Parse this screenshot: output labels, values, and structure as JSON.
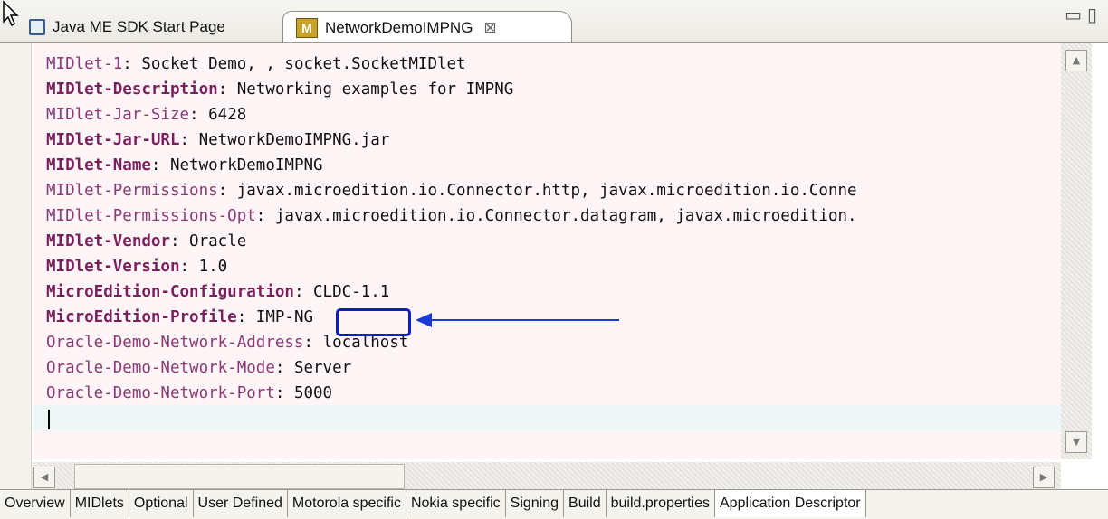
{
  "tabs": [
    {
      "label": "Java ME SDK Start Page",
      "icon": "start-page-icon"
    },
    {
      "label": "NetworkDemoIMPNG",
      "icon": "midlet-project-icon",
      "close": "⊠",
      "active": true
    }
  ],
  "editor": {
    "lines": [
      {
        "key": "MIDlet-1",
        "value": "Socket Demo, , socket.SocketMIDlet",
        "bold": false
      },
      {
        "key": "MIDlet-Description",
        "value": "Networking examples for IMPNG",
        "bold": true
      },
      {
        "key": "MIDlet-Jar-Size",
        "value": "6428",
        "bold": false
      },
      {
        "key": "MIDlet-Jar-URL",
        "value": "NetworkDemoIMPNG.jar",
        "bold": true
      },
      {
        "key": "MIDlet-Name",
        "value": "NetworkDemoIMPNG",
        "bold": true
      },
      {
        "key": "MIDlet-Permissions",
        "value": "javax.microedition.io.Connector.http, javax.microedition.io.Conne",
        "bold": false
      },
      {
        "key": "MIDlet-Permissions-Opt",
        "value": "javax.microedition.io.Connector.datagram, javax.microedition.",
        "bold": false
      },
      {
        "key": "MIDlet-Vendor",
        "value": "Oracle",
        "bold": true
      },
      {
        "key": "MIDlet-Version",
        "value": "1.0",
        "bold": true
      },
      {
        "key": "MicroEdition-Configuration",
        "value": "CLDC-1.1",
        "bold": true
      },
      {
        "key": "MicroEdition-Profile",
        "value": "IMP-NG",
        "bold": true
      },
      {
        "key": "Oracle-Demo-Network-Address",
        "value": "localhost",
        "bold": false
      },
      {
        "key": "Oracle-Demo-Network-Mode",
        "value": "Server",
        "bold": false
      },
      {
        "key": "Oracle-Demo-Network-Port",
        "value": "5000",
        "bold": false
      }
    ],
    "separator": ": "
  },
  "scroll": {
    "up": "▲",
    "down": "▼",
    "left": "◀",
    "right": "▶"
  },
  "bottom_tabs": [
    {
      "label": "Overview"
    },
    {
      "label": "MIDlets"
    },
    {
      "label": "Optional"
    },
    {
      "label": "User Defined"
    },
    {
      "label": "Motorola specific"
    },
    {
      "label": "Nokia specific"
    },
    {
      "label": "Signing"
    },
    {
      "label": "Build"
    },
    {
      "label": "build.properties"
    },
    {
      "label": "Application Descriptor",
      "active": true
    }
  ],
  "colors": {
    "annotation": "#1a3ad8",
    "key_text": "#8a3a78",
    "editor_bg": "#fff4f6"
  }
}
